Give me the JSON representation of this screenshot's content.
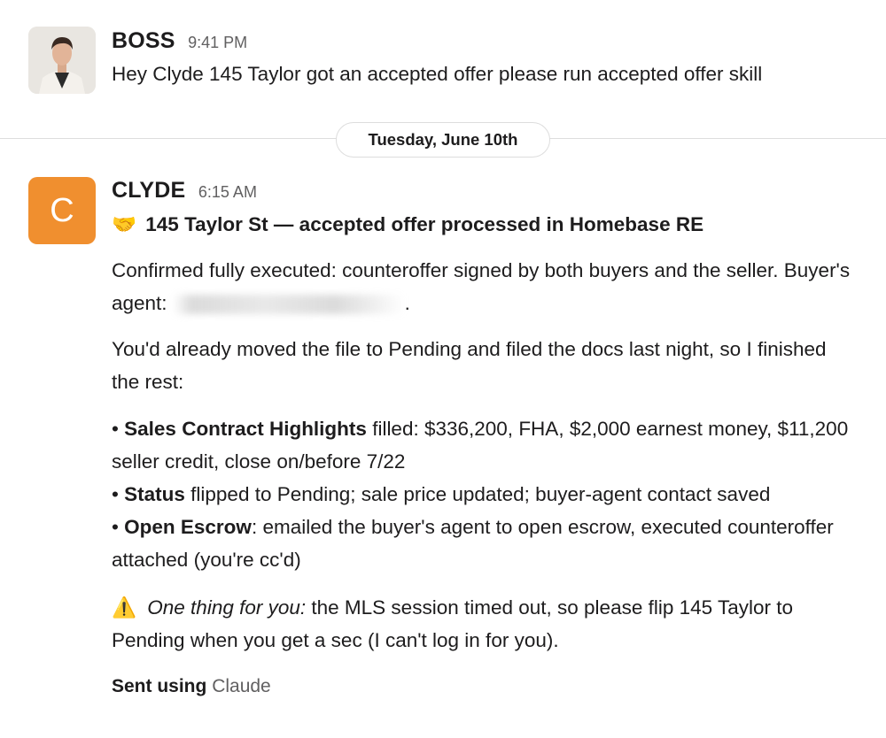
{
  "messages": [
    {
      "author": "BOSS",
      "time": "9:41 PM",
      "text": "Hey Clyde 145 Taylor got an accepted offer please run accepted offer skill"
    },
    {
      "author": "CLYDE",
      "avatar_letter": "C",
      "time": "6:15 AM",
      "title_emoji": "🤝",
      "title": "145 Taylor St — accepted offer processed in Homebase RE",
      "para1_a": "Confirmed fully executed: counteroffer signed by both buyers and the seller. Buyer's agent:",
      "para1_b": ".",
      "para2": "You'd already moved the file to Pending and filed the docs last night, so I finished the rest:",
      "bullets": [
        {
          "label": "Sales Contract Highlights",
          "text": " filled: $336,200, FHA, $2,000 earnest money, $11,200 seller credit, close on/before 7/22"
        },
        {
          "label": "Status",
          "text": " flipped to Pending; sale price updated; buyer-agent contact saved"
        },
        {
          "label": "Open Escrow",
          "text": ": emailed the buyer's agent to open escrow, executed counteroffer attached (you're cc'd)"
        }
      ],
      "warning_emoji": "⚠️",
      "warning_lead": "One thing for you:",
      "warning_text": " the MLS session timed out, so please flip 145 Taylor to Pending when you get a sec (I can't log in for you).",
      "sent_label": "Sent using",
      "sent_tool": "Claude"
    }
  ],
  "date_divider": "Tuesday, June 10th",
  "colors": {
    "clyde_avatar": "#f08f2f",
    "divider": "#dddddd"
  }
}
